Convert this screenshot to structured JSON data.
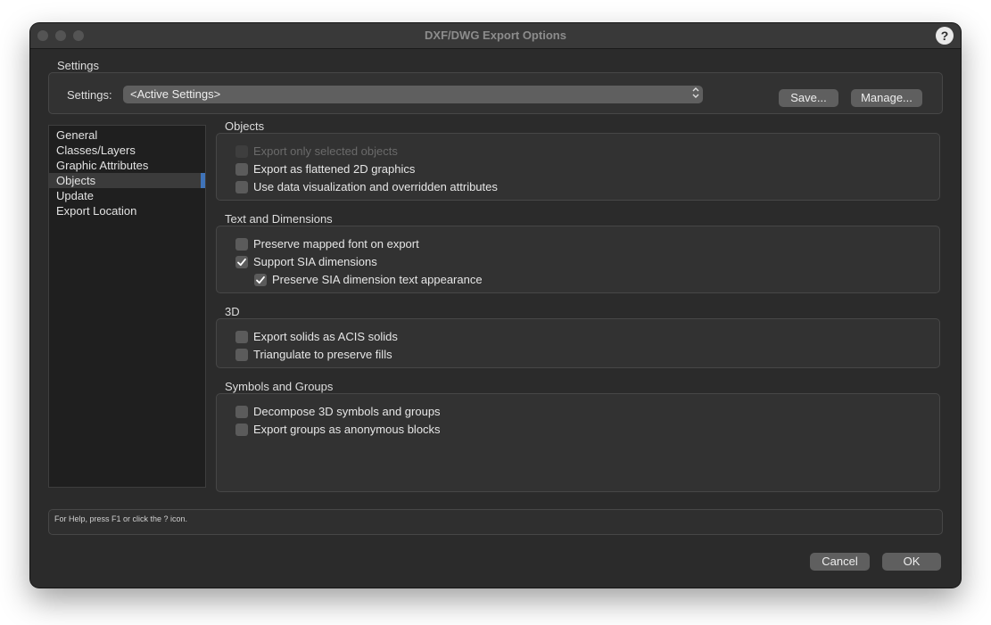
{
  "window": {
    "title": "DXF/DWG Export Options",
    "help_label": "?"
  },
  "settings": {
    "group_title": "Settings",
    "field_label": "Settings:",
    "selected": "<Active Settings>",
    "save_label": "Save...",
    "manage_label": "Manage..."
  },
  "sidebar": {
    "items": [
      {
        "label": "General"
      },
      {
        "label": "Classes/Layers"
      },
      {
        "label": "Graphic Attributes"
      },
      {
        "label": "Objects"
      },
      {
        "label": "Update"
      },
      {
        "label": "Export Location"
      }
    ],
    "selected_index": 3
  },
  "groups": {
    "objects": {
      "title": "Objects",
      "items": [
        {
          "label": "Export only selected objects",
          "checked": false,
          "disabled": true
        },
        {
          "label": "Export as flattened 2D graphics",
          "checked": false
        },
        {
          "label": "Use data visualization and overridden attributes",
          "checked": false
        }
      ]
    },
    "text_dimensions": {
      "title": "Text and Dimensions",
      "items": [
        {
          "label": "Preserve mapped font on export",
          "checked": false
        },
        {
          "label": "Support SIA dimensions",
          "checked": true
        },
        {
          "label": "Preserve SIA dimension text appearance",
          "checked": true
        }
      ]
    },
    "three_d": {
      "title": "3D",
      "items": [
        {
          "label": "Export solids as ACIS solids",
          "checked": false
        },
        {
          "label": "Triangulate to preserve fills",
          "checked": false
        }
      ]
    },
    "symbols_groups": {
      "title": "Symbols and Groups",
      "items": [
        {
          "label": "Decompose 3D symbols and groups",
          "checked": false
        },
        {
          "label": "Export groups as anonymous blocks",
          "checked": false
        }
      ]
    }
  },
  "status": {
    "text": "For Help, press F1 or click the ? icon."
  },
  "footer": {
    "cancel_label": "Cancel",
    "ok_label": "OK"
  }
}
